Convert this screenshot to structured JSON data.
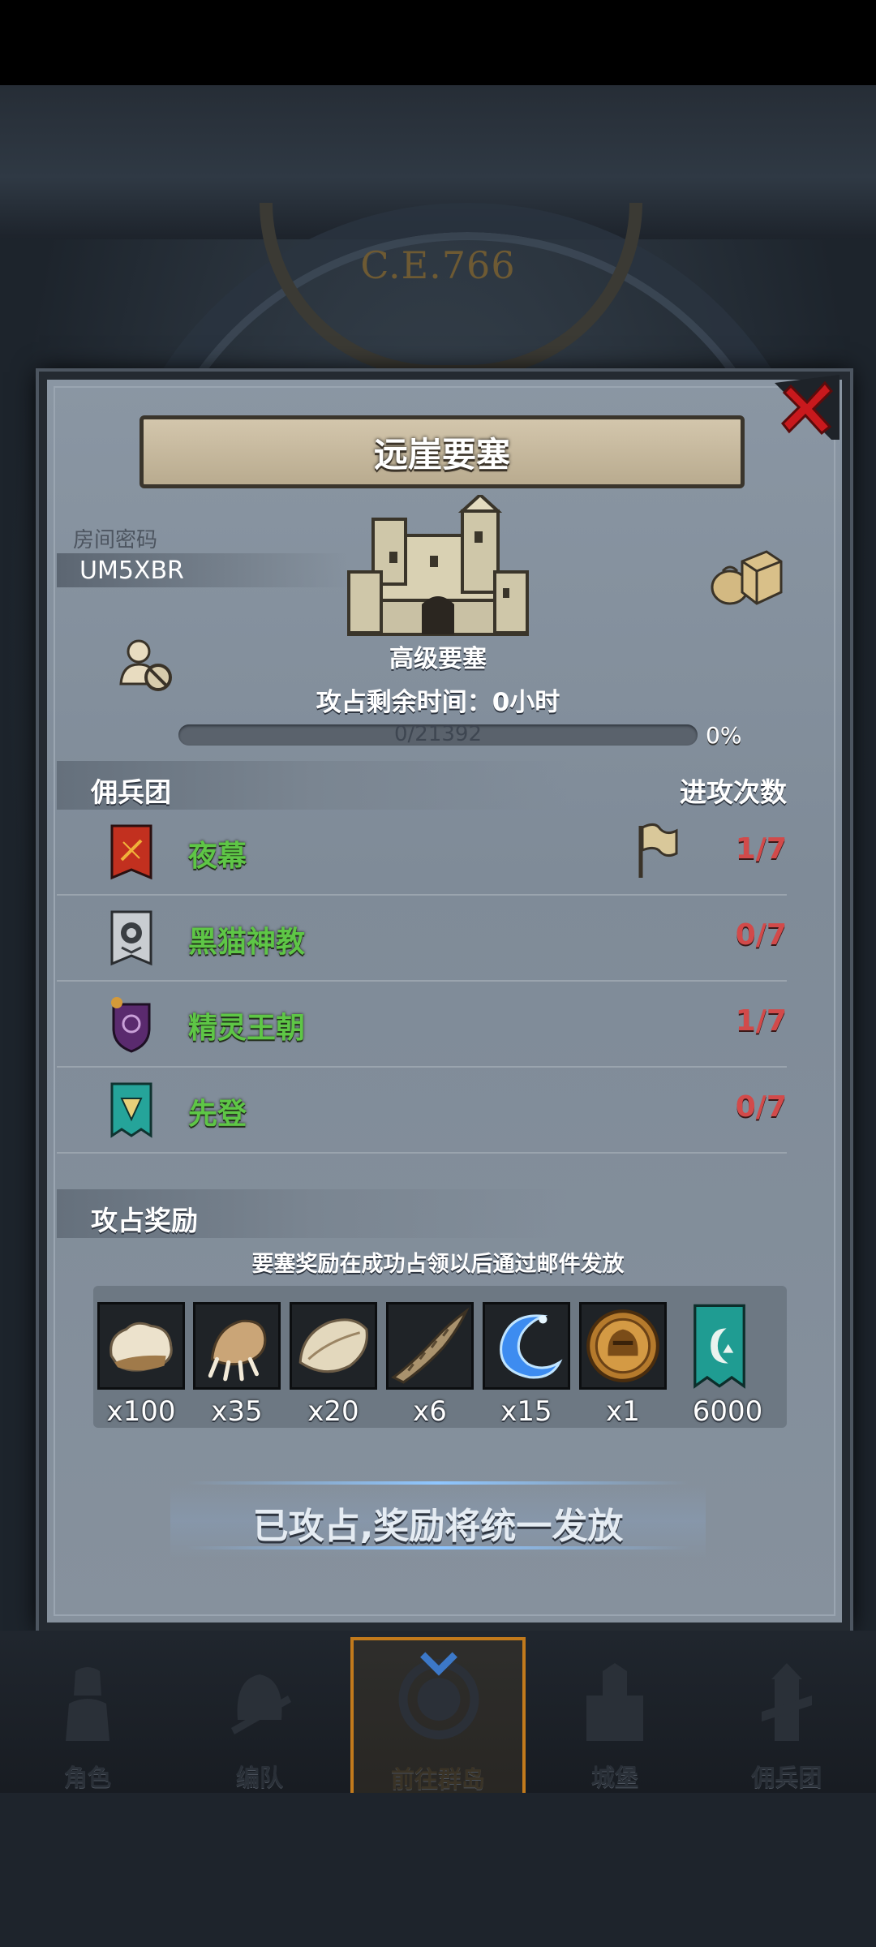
{
  "background": {
    "era": "C.E.766"
  },
  "dialog": {
    "title": "远崖要塞",
    "room_label": "房间密码",
    "room_code": "UM5XBR",
    "castle_name": "高级要塞",
    "timer_text": "攻占剩余时间：0小时",
    "progress": {
      "text": "0/21392",
      "current": 0,
      "max": 21392,
      "percent_text": "0%"
    },
    "guild_header": {
      "left": "佣兵团",
      "right": "进攻次数"
    },
    "guilds": [
      {
        "name": "夜幕",
        "count": "1/7",
        "emblem": "red-banner-icon",
        "flag": true
      },
      {
        "name": "黑猫神教",
        "count": "0/7",
        "emblem": "silver-banner-icon",
        "flag": false
      },
      {
        "name": "精灵王朝",
        "count": "1/7",
        "emblem": "purple-shield-icon",
        "flag": false
      },
      {
        "name": "先登",
        "count": "0/7",
        "emblem": "teal-banner-icon",
        "flag": false
      }
    ],
    "reward_header": "攻占奖励",
    "reward_note": "要塞奖励在成功占领以后通过邮件发放",
    "rewards": [
      {
        "icon": "fur-icon",
        "qty": "x100"
      },
      {
        "icon": "claw-icon",
        "qty": "x35"
      },
      {
        "icon": "pelt-icon",
        "qty": "x20"
      },
      {
        "icon": "horn-icon",
        "qty": "x6"
      },
      {
        "icon": "blue-crescent-icon",
        "qty": "x15"
      },
      {
        "icon": "knight-medal-icon",
        "qty": "x1"
      },
      {
        "icon": "teal-banner-icon",
        "qty": "6000"
      }
    ],
    "claim_text": "已攻占,奖励将统一发放"
  },
  "nav": [
    {
      "label": "角色",
      "icon": "knight-icon"
    },
    {
      "label": "编队",
      "icon": "helmet-icon"
    },
    {
      "label": "前往群岛",
      "icon": "compass-icon",
      "active": true
    },
    {
      "label": "城堡",
      "icon": "castle-icon"
    },
    {
      "label": "佣兵团",
      "icon": "tower-icon"
    }
  ],
  "colors": {
    "guild_name": "#5ec646",
    "attack_count": "#d24a4a",
    "active_tab": "#c27a1c"
  }
}
